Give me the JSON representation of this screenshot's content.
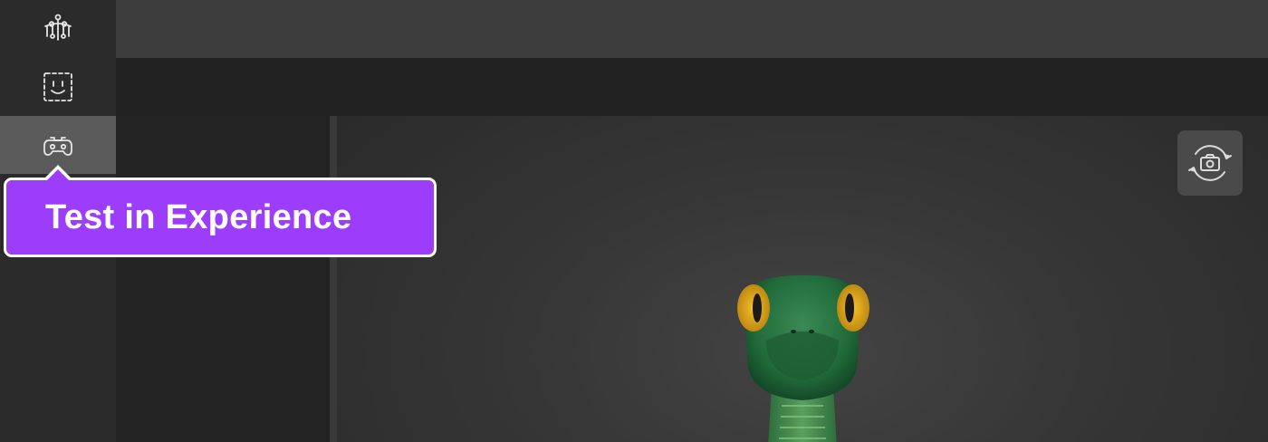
{
  "sidebar": {
    "items": [
      {
        "icon": "rig-nodes-icon",
        "active": false
      },
      {
        "icon": "face-frame-icon",
        "active": false
      },
      {
        "icon": "gamepad-icon",
        "active": true
      }
    ]
  },
  "tooltip": {
    "label": "Test in Experience",
    "color": "#9c3dfb"
  },
  "viewport": {
    "camera_button_icon": "camera-rotate-icon"
  }
}
